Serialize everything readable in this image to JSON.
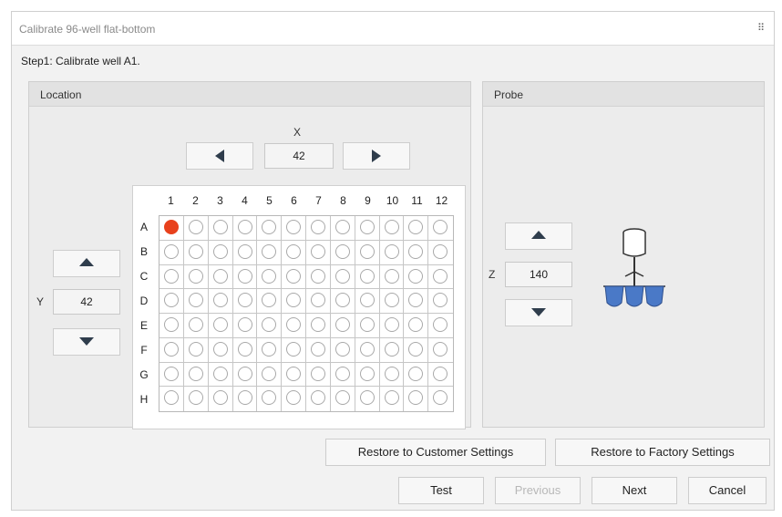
{
  "dialog": {
    "title": "Calibrate 96-well flat-bottom",
    "close_glyph": "⠿"
  },
  "step_text": "Step1: Calibrate well A1.",
  "location": {
    "header": "Location",
    "x_label": "X",
    "x_value": "42",
    "y_label": "Y",
    "y_value": "42"
  },
  "probe": {
    "header": "Probe",
    "z_label": "Z",
    "z_value": "140"
  },
  "plate": {
    "columns": [
      "1",
      "2",
      "3",
      "4",
      "5",
      "6",
      "7",
      "8",
      "9",
      "10",
      "11",
      "12"
    ],
    "rows": [
      "A",
      "B",
      "C",
      "D",
      "E",
      "F",
      "G",
      "H"
    ],
    "selected_well": "A1",
    "selected_color": "#e8411c"
  },
  "buttons": {
    "restore_customer": "Restore to Customer Settings",
    "restore_factory": "Restore to Factory Settings",
    "test": "Test",
    "previous": "Previous",
    "next": "Next",
    "cancel": "Cancel"
  },
  "icons": {
    "left": "left-arrow-icon",
    "right": "right-arrow-icon",
    "up": "up-arrow-icon",
    "down": "down-arrow-icon",
    "probe": "probe-illustration-icon"
  }
}
